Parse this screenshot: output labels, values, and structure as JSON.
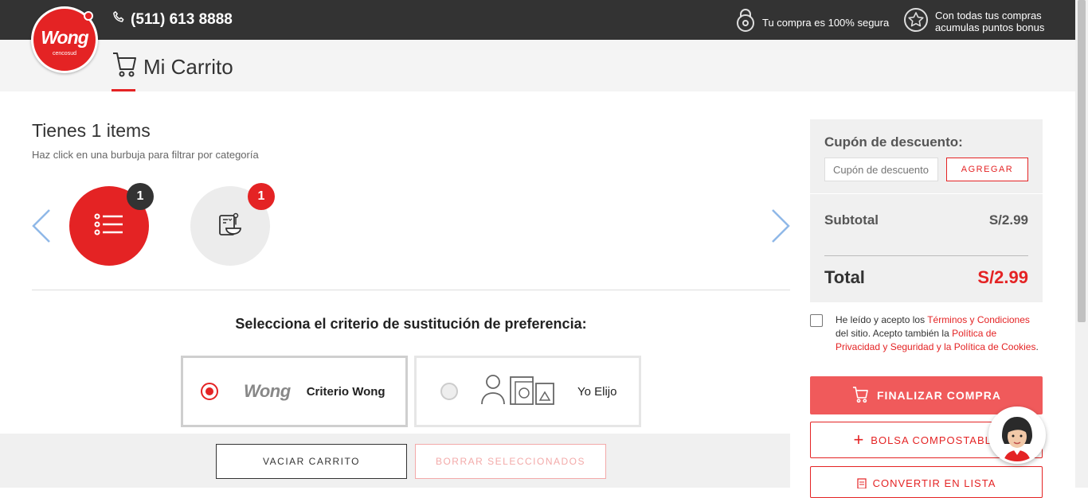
{
  "header": {
    "phone": "(511) 613 8888",
    "secure_text": "Tu compra es 100% segura",
    "bonus_line1": "Con todas tus compras",
    "bonus_line2": "acumulas puntos bonus"
  },
  "logo": {
    "brand": "Wong",
    "sub": "cencosud"
  },
  "page": {
    "title": "Mi Carrito"
  },
  "cart": {
    "title": "Tienes 1 items",
    "hint": "Haz click en una burbuja para filtrar por categoría",
    "bubbles": [
      {
        "category_icon": "list-icon",
        "count": "1"
      },
      {
        "category_icon": "grocery-icon",
        "count": "1"
      }
    ]
  },
  "substitution": {
    "title": "Selecciona el criterio de sustitución de preferencia:",
    "options": [
      {
        "logo": "Wong",
        "label": "Criterio Wong",
        "selected": true
      },
      {
        "label": "Yo Elijo",
        "selected": false
      }
    ]
  },
  "actions": {
    "empty_cart": "VACIAR CARRITO",
    "delete_selected": "BORRAR SELECCIONADOS"
  },
  "summary": {
    "coupon_label": "Cupón de descuento:",
    "coupon_placeholder": "Cupón de descuento",
    "coupon_button": "AGREGAR",
    "subtotal_label": "Subtotal",
    "subtotal_value": "S/2.99",
    "total_label": "Total",
    "total_value": "S/2.99"
  },
  "terms": {
    "t1": "He leído y acepto los ",
    "link1": "Términos y Condiciones",
    "t2": " del sitio. Acepto también la ",
    "link2": "Política de Privacidad y Seguridad y la Política de Cookies",
    "t3": "."
  },
  "checkout": {
    "finalize": "FINALIZAR COMPRA",
    "compost_bag": "BOLSA COMPOSTABLE",
    "convert_list": "CONVERTIR EN LISTA"
  },
  "colors": {
    "brand_red": "#e42324",
    "button_red": "#f05a5b",
    "dark": "#333333"
  }
}
